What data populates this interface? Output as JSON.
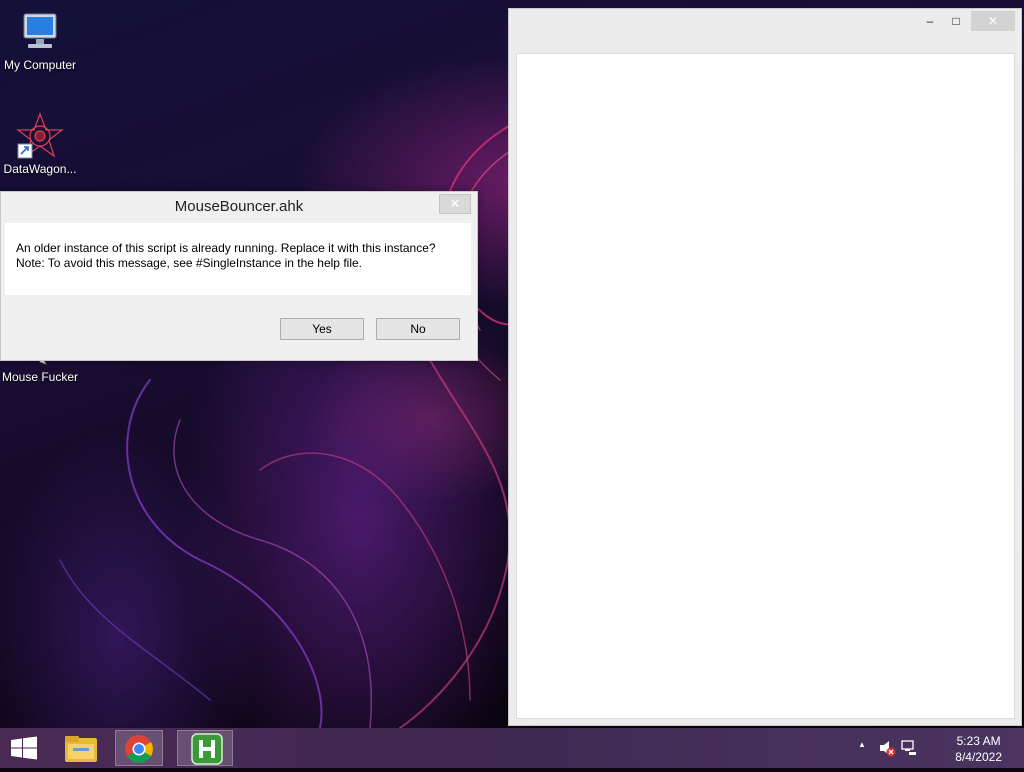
{
  "desktop": {
    "icons": [
      {
        "label": "My Computer",
        "icon": "computer-icon"
      },
      {
        "label": "DataWagon...",
        "icon": "datawagon-icon"
      },
      {
        "label": "Mouse Fucker",
        "icon": "cursor-icon"
      }
    ]
  },
  "blank_window": {
    "minimize": "–",
    "maximize": "□",
    "close": "✕"
  },
  "dialog": {
    "title": "MouseBouncer.ahk",
    "close": "✕",
    "message_line1": "An older instance of this script is already running.  Replace it with this instance?",
    "message_line2": "Note: To avoid this message, see #SingleInstance in the help file.",
    "yes_label": "Yes",
    "no_label": "No"
  },
  "taskbar": {
    "apps": [
      "windows-start-icon",
      "file-explorer-icon",
      "chrome-icon",
      "autohotkey-icon"
    ],
    "tray": {
      "chevron": "▲",
      "time": "5:23 AM",
      "date": "8/4/2022"
    }
  },
  "colors": {
    "taskbar": "#4a2a55",
    "dialog_bg": "#f0f0f0",
    "button_border": "#adadad"
  }
}
